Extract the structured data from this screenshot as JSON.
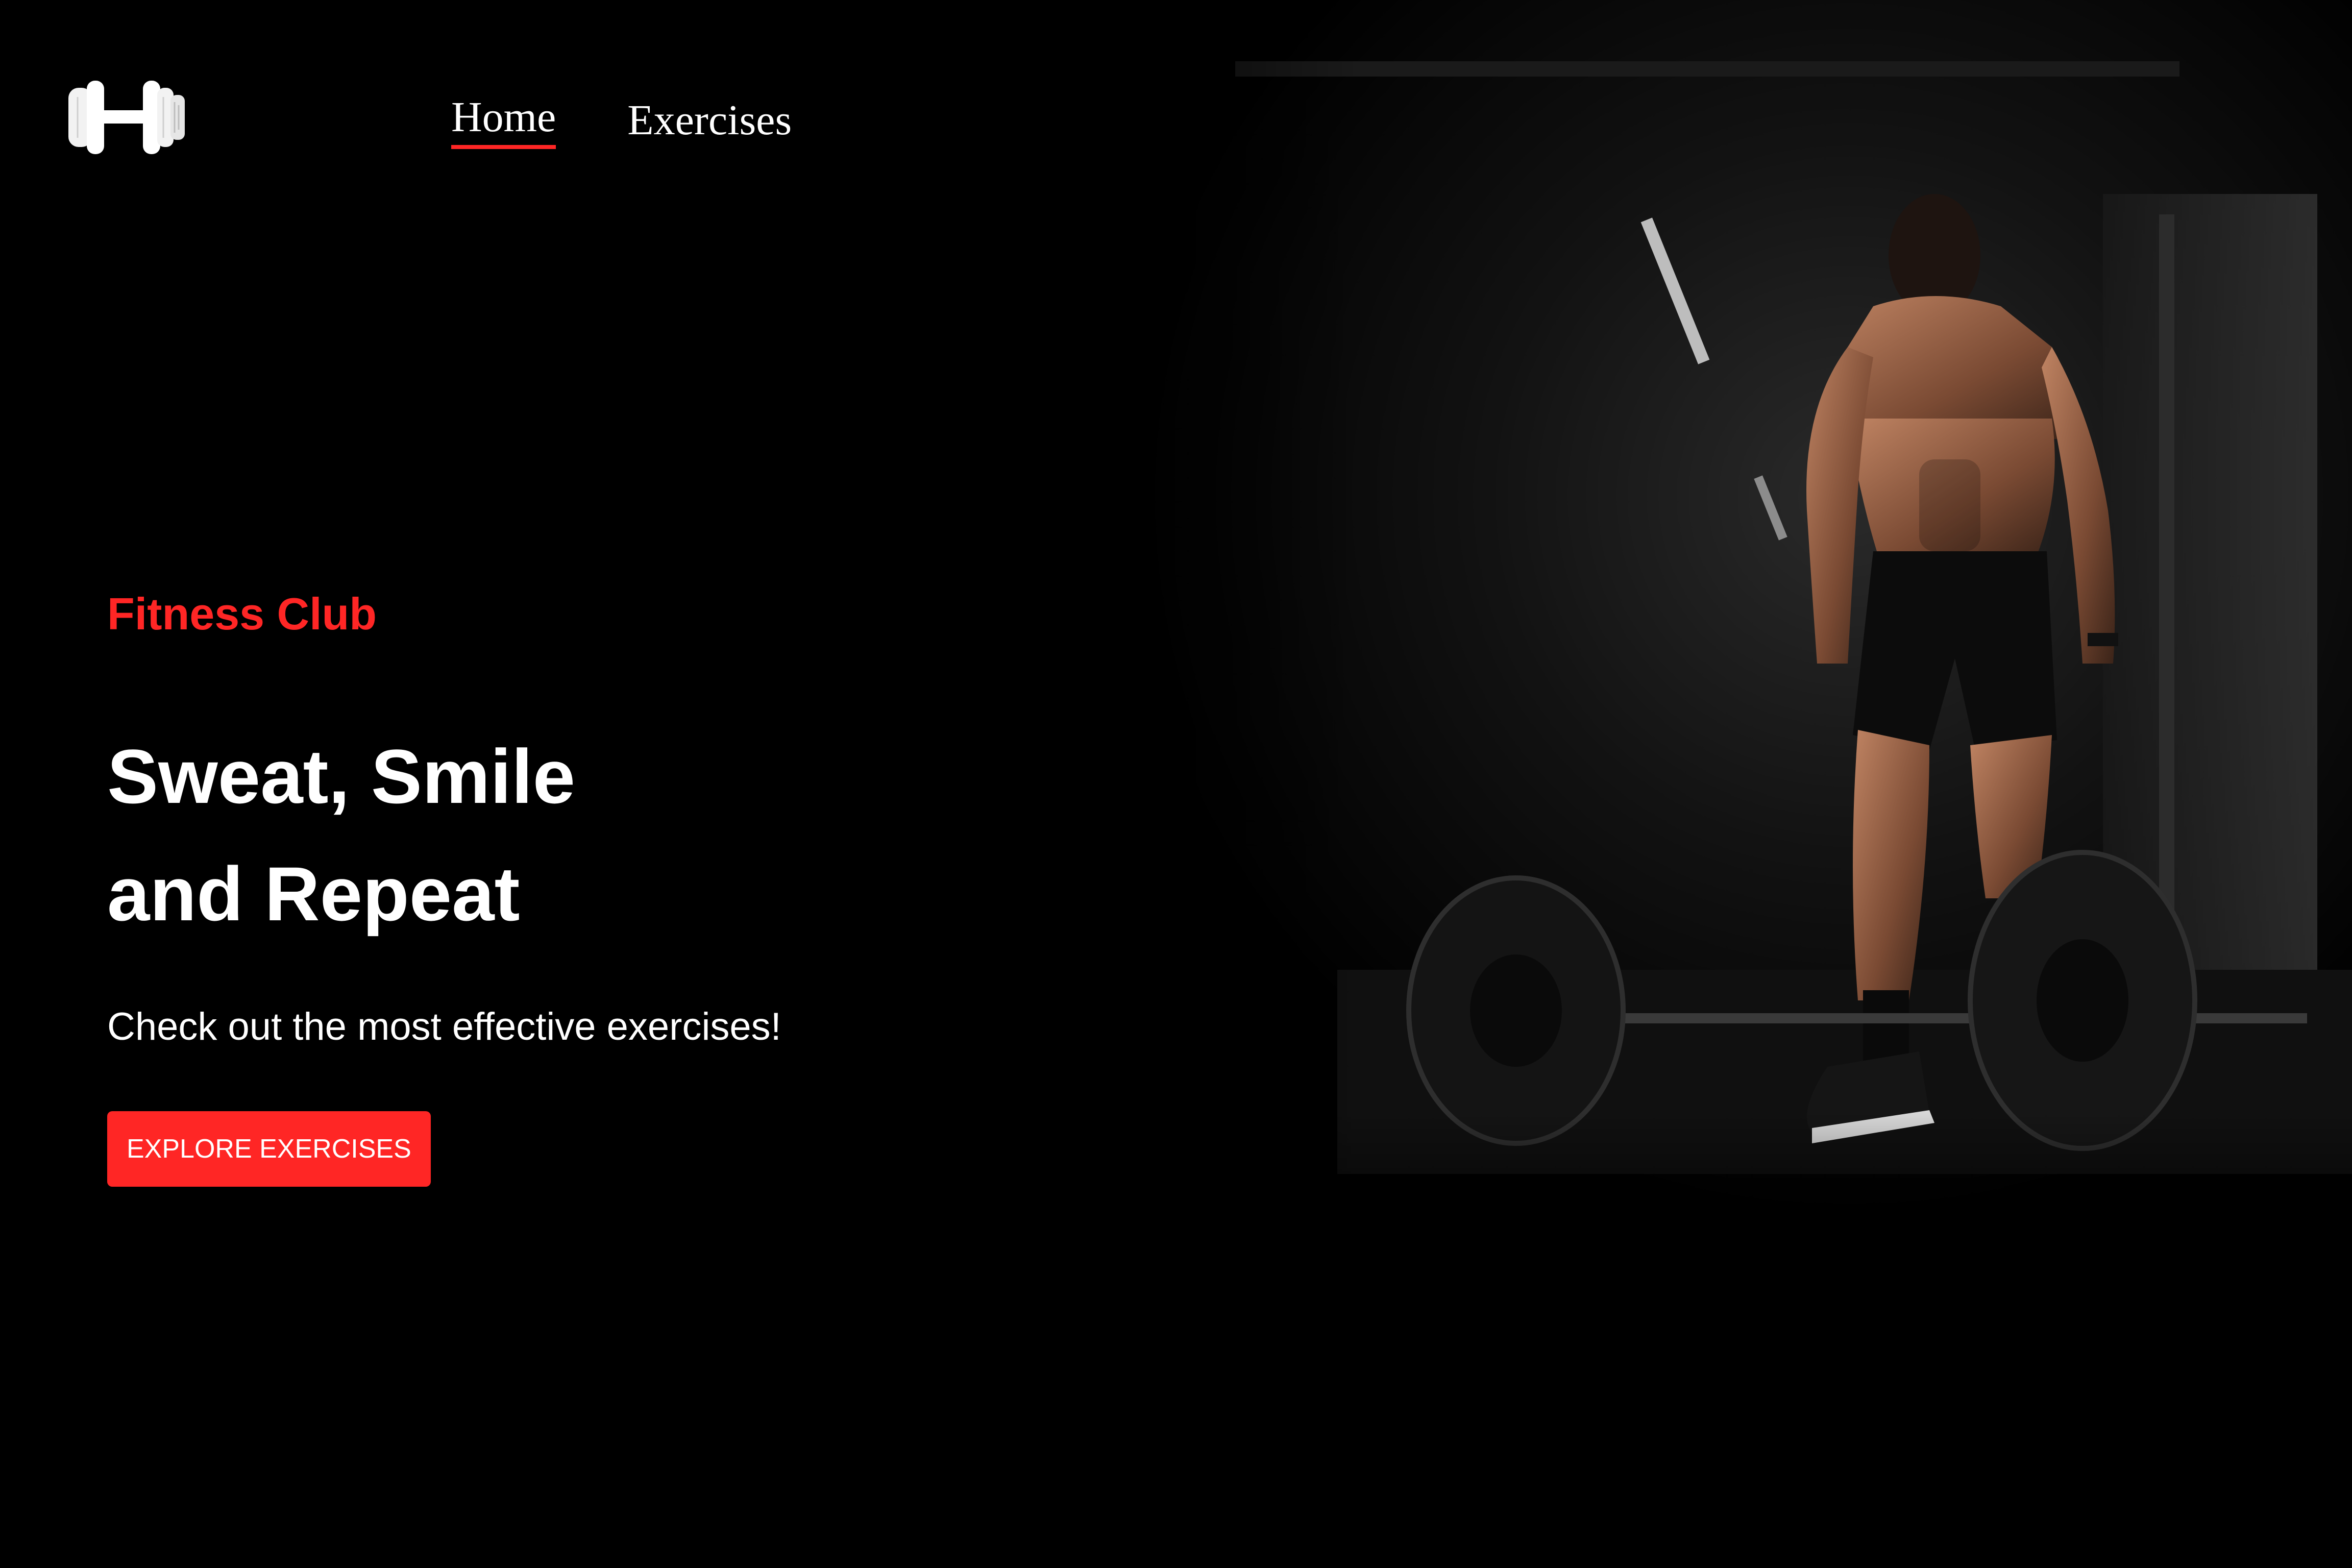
{
  "header": {
    "logo_icon": "dumbbell-icon",
    "nav": [
      {
        "label": "Home",
        "active": true
      },
      {
        "label": "Exercises",
        "active": false
      }
    ]
  },
  "hero": {
    "eyebrow": "Fitness Club",
    "title_line1": "Sweat, Smile",
    "title_line2": "and Repeat",
    "subtitle": "Check out the most effective exercises!",
    "cta_label": "EXPLORE EXERCISES"
  },
  "colors": {
    "background": "#000000",
    "accent": "#ff2625",
    "text": "#ffffff"
  },
  "image": {
    "subject": "banner-athlete-barbell-image"
  }
}
